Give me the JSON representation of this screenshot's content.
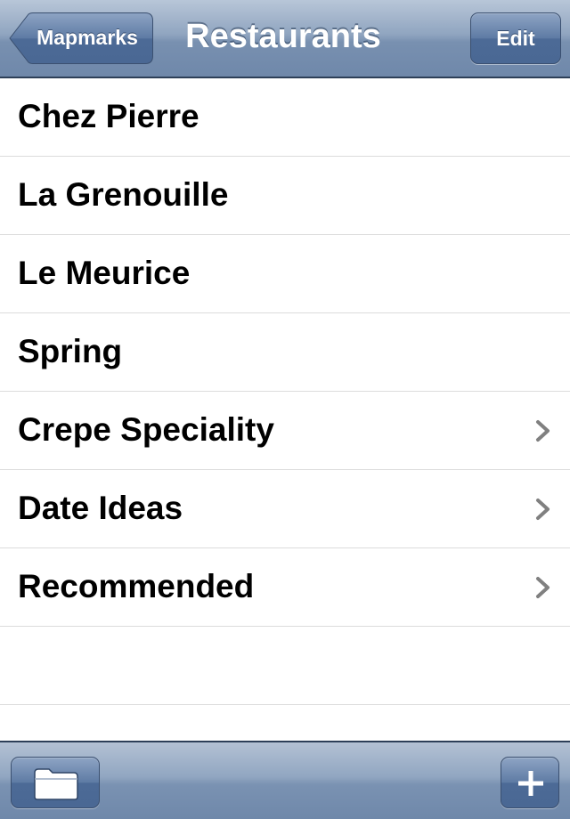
{
  "navbar": {
    "title": "Restaurants",
    "back_label": "Mapmarks",
    "edit_label": "Edit"
  },
  "list": {
    "items": [
      {
        "label": "Chez Pierre",
        "has_disclosure": false
      },
      {
        "label": "La Grenouille",
        "has_disclosure": false
      },
      {
        "label": "Le Meurice",
        "has_disclosure": false
      },
      {
        "label": "Spring",
        "has_disclosure": false
      },
      {
        "label": "Crepe Speciality",
        "has_disclosure": true,
        "icon": "chevron-right-icon"
      },
      {
        "label": "Date Ideas",
        "has_disclosure": true,
        "icon": "chevron-right-icon"
      },
      {
        "label": "Recommended",
        "has_disclosure": true,
        "icon": "chevron-right-icon"
      }
    ]
  },
  "toolbar": {
    "left_icon": "folder-icon",
    "right_icon": "plus-icon"
  },
  "colors": {
    "bar_blue": "#6f88aa",
    "bar_light": "#b8c6d8",
    "separator": "#dcdcdc",
    "chevron": "#808080"
  }
}
